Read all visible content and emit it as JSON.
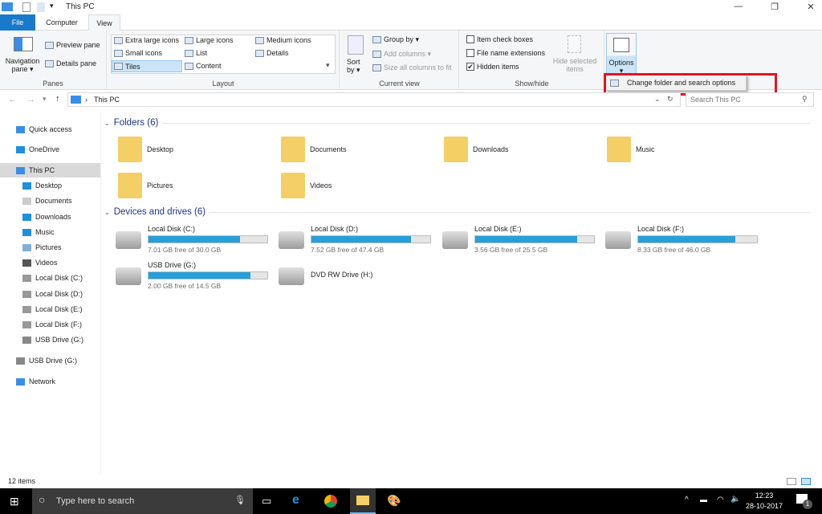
{
  "window": {
    "title": "This PC",
    "controls": [
      "minimize",
      "restore",
      "close"
    ]
  },
  "tabs": [
    {
      "label": "File"
    },
    {
      "label": "Computer"
    },
    {
      "label": "View"
    }
  ],
  "ribbon": {
    "panes": {
      "label": "Panes",
      "nav": "Navigation",
      "nav2": "pane ▾",
      "preview": "Preview pane",
      "details": "Details pane"
    },
    "layout": {
      "label": "Layout",
      "items": [
        "Extra large icons",
        "Large icons",
        "Medium icons",
        "Small icons",
        "List",
        "Details",
        "Tiles",
        "Content"
      ],
      "selected": "Tiles"
    },
    "current_view": {
      "label": "Current view",
      "sort": "Sort",
      "sort2": "by ▾",
      "group": "Group by ▾",
      "add": "Add columns ▾",
      "size": "Size all columns to fit"
    },
    "show_hide": {
      "label": "Show/hide",
      "item_check": "Item check boxes",
      "item_check_on": false,
      "ext": "File name extensions",
      "ext_on": false,
      "hidden": "Hidden items",
      "hidden_on": true,
      "hide_sel": "Hide selected",
      "hide_sel2": "items"
    },
    "options": {
      "label": "Options",
      "arrow": "▾",
      "menu_item": "Change folder and search options"
    }
  },
  "address": {
    "path": "This PC",
    "search_placeholder": "Search This PC"
  },
  "sidebar": [
    {
      "label": "Quick access",
      "icon": "star-icon",
      "indent": 0
    },
    {
      "label": "OneDrive",
      "icon": "cloud-icon",
      "indent": 0
    },
    {
      "label": "This PC",
      "icon": "computer-icon",
      "indent": 0,
      "selected": true
    },
    {
      "label": "Desktop",
      "icon": "desktop-icon",
      "indent": 1
    },
    {
      "label": "Documents",
      "icon": "documents-icon",
      "indent": 1
    },
    {
      "label": "Downloads",
      "icon": "download-icon",
      "indent": 1
    },
    {
      "label": "Music",
      "icon": "music-icon",
      "indent": 1
    },
    {
      "label": "Pictures",
      "icon": "pictures-icon",
      "indent": 1
    },
    {
      "label": "Videos",
      "icon": "videos-icon",
      "indent": 1
    },
    {
      "label": "Local Disk (C:)",
      "icon": "drive-icon",
      "indent": 1
    },
    {
      "label": "Local Disk (D:)",
      "icon": "drive-icon",
      "indent": 1
    },
    {
      "label": "Local Disk (E:)",
      "icon": "drive-icon",
      "indent": 1
    },
    {
      "label": "Local Disk  (F:)",
      "icon": "drive-icon",
      "indent": 1
    },
    {
      "label": "USB Drive (G:)",
      "icon": "usb-icon",
      "indent": 1
    },
    {
      "label": "USB Drive (G:)",
      "icon": "usb-icon",
      "indent": 0
    },
    {
      "label": "Network",
      "icon": "network-icon",
      "indent": 0
    }
  ],
  "folders": {
    "header": "Folders (6)",
    "items": [
      "Desktop",
      "Documents",
      "Downloads",
      "Music",
      "Pictures",
      "Videos"
    ]
  },
  "drives": {
    "header": "Devices and drives (6)",
    "items": [
      {
        "name": "Local Disk (C:)",
        "free": "7.01 GB free of 30.0 GB",
        "used_pct": 77
      },
      {
        "name": "Local Disk (D:)",
        "free": "7.52 GB free of 47.4 GB",
        "used_pct": 84
      },
      {
        "name": "Local Disk (E:)",
        "free": "3.56 GB free of 25.5 GB",
        "used_pct": 86
      },
      {
        "name": "Local Disk  (F:)",
        "free": "8.33 GB free of 46.0 GB",
        "used_pct": 82
      },
      {
        "name": "USB Drive (G:)",
        "free": "2.00 GB free of 14.5 GB",
        "used_pct": 86
      },
      {
        "name": "DVD RW Drive (H:)"
      }
    ]
  },
  "status": "12 items",
  "taskbar": {
    "search": "Type here to search",
    "time": "12:23",
    "date": "28-10-2017",
    "notifications": "1"
  },
  "colors": {
    "accent": "#1979ca",
    "bar": "#26a0da",
    "highlight": "#e81123"
  }
}
